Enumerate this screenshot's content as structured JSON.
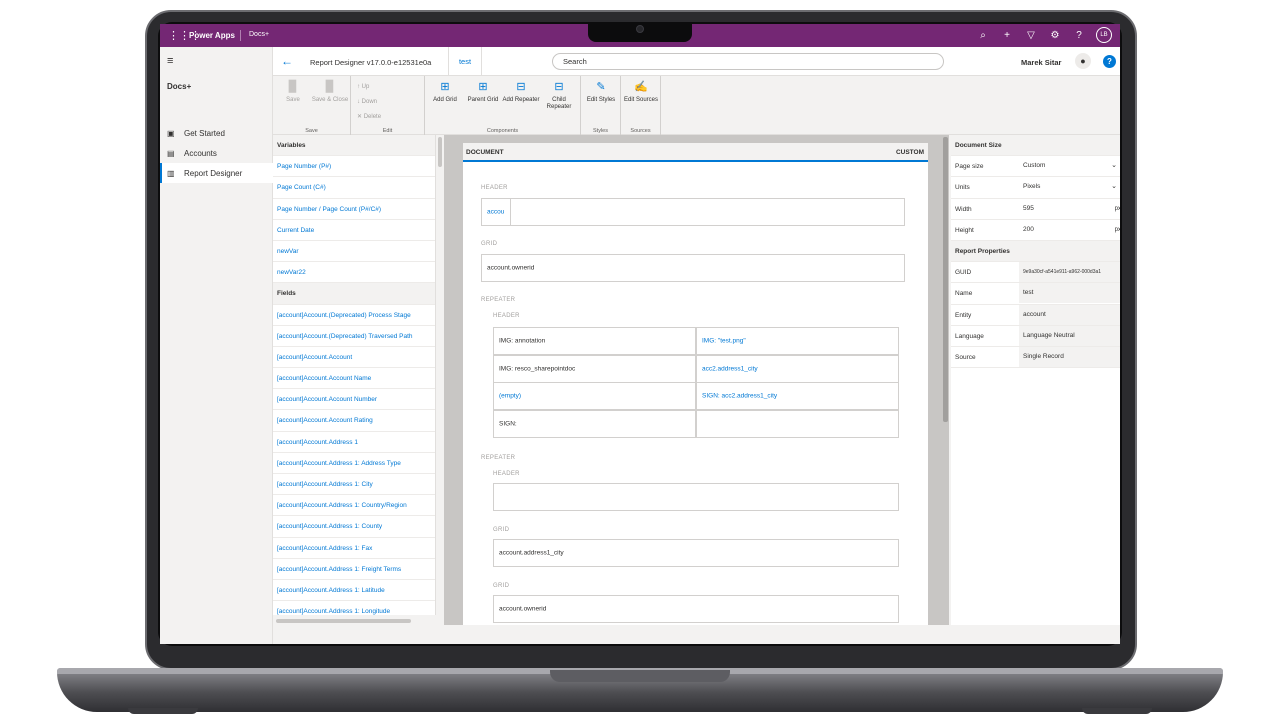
{
  "topbar": {
    "brand": "Power Apps",
    "app_name": "Docs+",
    "avatar_initials": "LB",
    "icons": [
      "waffle-icon",
      "search-icon",
      "plus-icon",
      "filter-icon",
      "gear-icon",
      "question-icon"
    ]
  },
  "sidebar": {
    "title": "Docs+",
    "items": [
      {
        "label": "Get Started",
        "icon": "home-icon"
      },
      {
        "label": "Accounts",
        "icon": "building-icon"
      },
      {
        "label": "Report Designer",
        "icon": "book-icon",
        "active": true
      }
    ]
  },
  "cmdbar": {
    "title": "Report Designer v17.0.0-e12531e0a",
    "tab": "test",
    "search_placeholder": "Search",
    "user_name": "Marek Sitar",
    "help": "?"
  },
  "ribbon": {
    "groups": {
      "save": {
        "label": "Save",
        "buttons": [
          "Save",
          "Save & Close"
        ]
      },
      "edit": {
        "label": "Edit",
        "buttons": [
          "Up",
          "Down",
          "Delete"
        ]
      },
      "components": {
        "label": "Components",
        "buttons": [
          "Add Grid",
          "Parent Grid",
          "Add Repeater",
          "Child Repeater"
        ]
      },
      "styles": {
        "label": "Styles",
        "buttons": [
          "Edit Styles"
        ]
      },
      "sources": {
        "label": "Sources",
        "buttons": [
          "Edit Sources"
        ]
      }
    }
  },
  "left_panel": {
    "variables_title": "Variables",
    "variables": [
      "Page Number (P#)",
      "Page Count (C#)",
      "Page Number / Page Count (P#/C#)",
      "Current Date",
      "newVar",
      "newVar22"
    ],
    "fields_title": "Fields",
    "fields": [
      "[account]Account.(Deprecated) Process Stage",
      "[account]Account.(Deprecated) Traversed Path",
      "[account]Account.Account",
      "[account]Account.Account Name",
      "[account]Account.Account Number",
      "[account]Account.Account Rating",
      "[account]Account.Address 1",
      "[account]Account.Address 1: Address Type",
      "[account]Account.Address 1: City",
      "[account]Account.Address 1: Country/Region",
      "[account]Account.Address 1: County",
      "[account]Account.Address 1: Fax",
      "[account]Account.Address 1: Freight Terms",
      "[account]Account.Address 1: Latitude",
      "[account]Account.Address 1: Longitude"
    ]
  },
  "document": {
    "title": "DOCUMENT",
    "mode": "CUSTOM",
    "labels": {
      "header": "HEADER",
      "grid": "GRID",
      "repeater": "REPEATER"
    },
    "header_cell": "accou",
    "grid1_cell": "account.ownerid",
    "repeater1_cells": [
      [
        "IMG: annotation",
        "IMG: \"test.png\""
      ],
      [
        "IMG: resco_sharepointdoc",
        "acc2.address1_city"
      ],
      [
        "(empty)",
        "SIGN: acc2.address1_city"
      ],
      [
        "SIGN:",
        ""
      ]
    ],
    "grid2_cell": "account.address1_city",
    "grid3_cell": "account.ownerid"
  },
  "right_panel": {
    "doc_size_title": "Document Size",
    "doc_size": [
      {
        "key": "Page size",
        "value": "Custom",
        "dropdown": true
      },
      {
        "key": "Units",
        "value": "Pixels",
        "dropdown": true
      },
      {
        "key": "Width",
        "value": "595",
        "unit": "px"
      },
      {
        "key": "Height",
        "value": "200",
        "unit": "px"
      }
    ],
    "report_props_title": "Report Properties",
    "report_props": [
      {
        "key": "GUID",
        "value": "9e9a30cf-a541e911-a962-000d3a1"
      },
      {
        "key": "Name",
        "value": "test"
      },
      {
        "key": "Entity",
        "value": "account"
      },
      {
        "key": "Language",
        "value": "Language Neutral"
      },
      {
        "key": "Source",
        "value": "Single Record"
      }
    ]
  },
  "colors": {
    "topbar": "#742774",
    "accent": "#0078d4"
  }
}
